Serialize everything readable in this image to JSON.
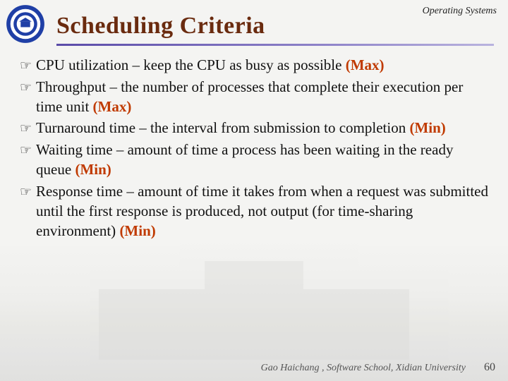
{
  "header": {
    "course_label": "Operating Systems",
    "title": "Scheduling Criteria"
  },
  "bullets": [
    {
      "text": "CPU utilization – keep the CPU as busy as possible ",
      "goal": "(Max)"
    },
    {
      "text": "Throughput – the number of processes that complete their execution per time unit ",
      "goal": "(Max)"
    },
    {
      "text": "Turnaround time – the interval from submission to completion ",
      "goal": "(Min)"
    },
    {
      "text": "Waiting time – amount of time a process has been waiting in the ready queue ",
      "goal": "(Min)"
    },
    {
      "text": "Response time – amount of time it takes from when a request was submitted until the first response is produced, not output (for time-sharing environment) ",
      "goal": "(Min)"
    }
  ],
  "footer": {
    "credit": "Gao Haichang , Software School, Xidian University",
    "page": "60"
  }
}
